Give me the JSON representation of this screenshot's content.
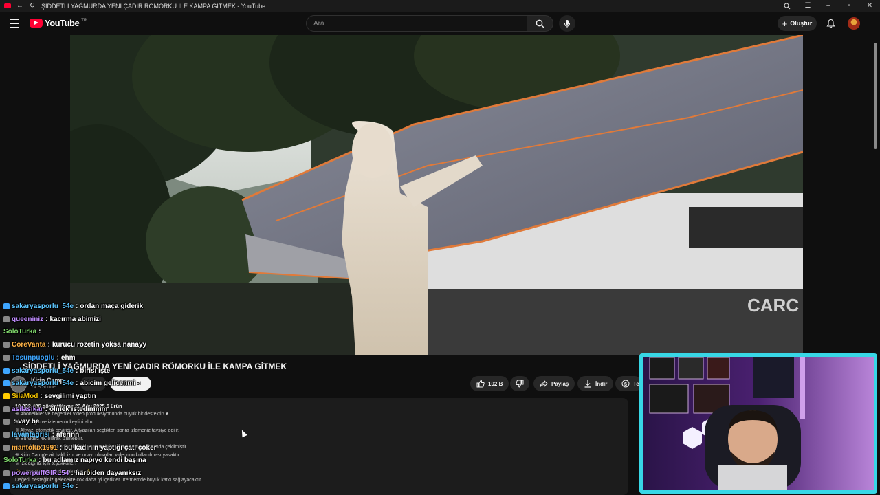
{
  "window": {
    "tab_label": "YouTube",
    "title": "ŞİDDETLİ YAĞMURDA YENİ ÇADIR RÖMORKU İLE KAMPA GİTMEK - YouTube"
  },
  "masthead": {
    "logo_text": "YouTube",
    "country_code": "TR",
    "search_placeholder": "Ara",
    "create_label": "Oluştur"
  },
  "video": {
    "title": "ŞİDDETLİ YAĞMURDA YENİ ÇADIR RÖMORKU İLE KAMPA GİTMEK",
    "channel_name": "Kirin Camp",
    "channel_subs": "74 B abone",
    "join_label": "Katıl",
    "subscribe_label": "Abone ol",
    "like_count": "102 B",
    "share_label": "Paylaş",
    "download_label": "İndir",
    "more_label": "Te",
    "stats": "10.332.486 görüntüleme  23 Ağu 2025  5 ürün",
    "description": [
      "※ Abonelikler ve beğeniler video prodüksiyonunda büyük bir destektir! ♥",
      "※ Sesi açın ve izlemenin keyfini alın!",
      "※ Altyazı otomatik çeviridir. Altyazıları seçtikten sonra izlemeniz tavsiye edilir.",
      "※ Bu video 4K olarak izlenebilir.",
      "※ Bu video güvenlik önlemleri alınarak ve izin alınarak kamp alanında çekilmiştir.",
      "※ Kirin Camp'e ait haklı izni ve onayı olmadan videonun kullanılması yasaktır.",
      "※ İzlediğiniz için teşekkürler!",
      "✨ Bana üye olarak destek olun ✨",
      "Değerli desteğiniz gelecekte çok daha iyi içerikler üretmemde büyük katkı sağlayacaktır."
    ]
  },
  "chat": [
    {
      "user": "sakaryasporlu_54e",
      "msg": "ordan maça giderik",
      "color": "#5cc6ff",
      "badge": "#3ea6ff"
    },
    {
      "user": "queeniniz",
      "msg": "kacırma abimizi",
      "color": "#c08cff",
      "badge": "#888888"
    },
    {
      "user": "SoloTurka",
      "msg": "",
      "color": "#7fd66b",
      "badge": ""
    },
    {
      "user": "CoreVanta",
      "msg": "kurucu rozetin yoksa nanayy",
      "color": "#ffb347",
      "badge": "#888888"
    },
    {
      "user": "Tosunpuoglu",
      "msg": "ehm",
      "color": "#3ea6ff",
      "badge": "#888888"
    },
    {
      "user": "sakaryasporlu_54e",
      "msg": "birisi işte",
      "color": "#5cc6ff",
      "badge": "#3ea6ff"
    },
    {
      "user": "sakaryasporlu_54e",
      "msg": "abicim gelicenmi",
      "color": "#5cc6ff",
      "badge": "#3ea6ff"
    },
    {
      "user": "SilaMod",
      "msg": "sevgilimi yaptın",
      "color": "#ffcc00",
      "badge": "#ffcc00"
    },
    {
      "user": "asilasikar",
      "msg": "ölmek istedimmm",
      "color": "#c08cff",
      "badge": "#888888"
    },
    {
      "user": "",
      "msg": "vay be",
      "color": "#ff6b6b",
      "badge": "#888888"
    },
    {
      "user": "lavantagrisi",
      "msg": "aferinn",
      "color": "#5cc6ff",
      "badge": "#888888"
    },
    {
      "user": "mantolux1991",
      "msg": "bu kadının yaptığı çatı çöker",
      "color": "#ffb347",
      "badge": "#888888"
    },
    {
      "user": "SoloTurka",
      "msg": "bu adlamız napıyo kendi başına",
      "color": "#7fd66b",
      "badge": ""
    },
    {
      "user": "powerpuffGIRL54",
      "msg": "harbiden dayanıksız",
      "color": "#c08cff",
      "badge": "#888888"
    },
    {
      "user": "sakaryasporlu_54e",
      "msg": "",
      "color": "#5cc6ff",
      "badge": "#3ea6ff"
    }
  ]
}
